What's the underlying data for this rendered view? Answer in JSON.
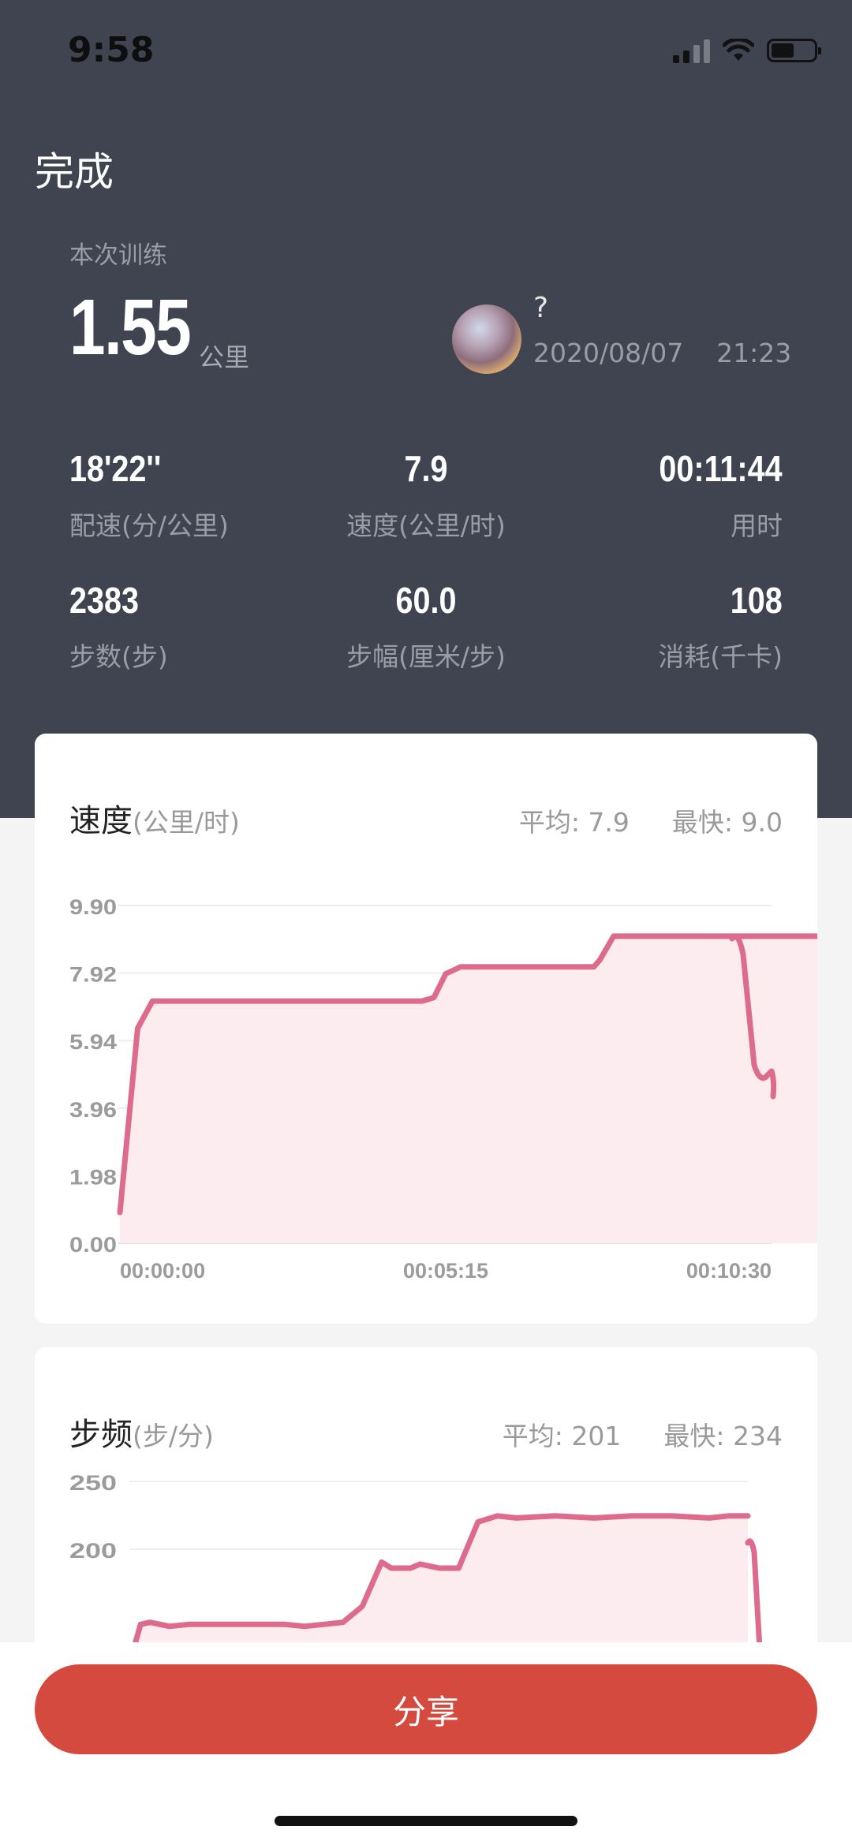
{
  "status": {
    "time": "9:58"
  },
  "header": {
    "done_label": "完成"
  },
  "summary": {
    "session_label": "本次训练",
    "distance": "1.55",
    "distance_unit": "公里",
    "username": "?",
    "date": "2020/08/07",
    "time": "21:23"
  },
  "stats": [
    {
      "value": "18'22''",
      "label": "配速(分/公里)"
    },
    {
      "value": "7.9",
      "label": "速度(公里/时)"
    },
    {
      "value": "00:11:44",
      "label": "用时"
    },
    {
      "value": "2383",
      "label": "步数(步)"
    },
    {
      "value": "60.0",
      "label": "步幅(厘米/步)"
    },
    {
      "value": "108",
      "label": "消耗(千卡)"
    }
  ],
  "speed_card": {
    "title": "速度",
    "unit": "(公里/时)",
    "avg_label": "平均: 7.9",
    "max_label": "最快: 9.0"
  },
  "cadence_card": {
    "title": "步频",
    "unit": "(步/分)",
    "avg_label": "平均: 201",
    "max_label": "最快: 234"
  },
  "share_label": "分享",
  "colors": {
    "line": "#dd6b8d",
    "fill": "#fcecef",
    "button": "#d44a3f",
    "header_bg": "#404350"
  },
  "chart_data": [
    {
      "type": "area",
      "yticks": [
        "0.00",
        "1.98",
        "3.96",
        "5.94",
        "7.92",
        "9.90"
      ],
      "xticks": [
        "00:00:00",
        "00:05:15",
        "00:10:30"
      ],
      "ylim": [
        0,
        9.9
      ],
      "xlim": [
        0,
        660
      ],
      "x": [
        0,
        18,
        33,
        66,
        120,
        180,
        220,
        270,
        306,
        318,
        330,
        345,
        380,
        430,
        480,
        486,
        500,
        520,
        540,
        560,
        600,
        640,
        654,
        662,
        665,
        680,
        695,
        710,
        720,
        730,
        740,
        750,
        760
      ],
      "series": [
        {
          "values": [
            0.9,
            6.3,
            7.1,
            7.1,
            7.1,
            7.1,
            7.1,
            7.1,
            7.1,
            7.2,
            7.9,
            8.1,
            8.1,
            8.1,
            8.1,
            8.3,
            9.0,
            9.0,
            9.0,
            9.0,
            9.0,
            9.0,
            9.0,
            9.0,
            9.0,
            9.0,
            9.0,
            9.0,
            9.0,
            9.0,
            9.0,
            9.05,
            9.0
          ]
        }
      ]
    },
    {
      "type": "area",
      "yticks": [
        "250",
        "200"
      ],
      "xticks": [],
      "x": [
        0,
        10,
        20,
        40,
        60,
        80,
        120,
        160,
        180,
        200,
        220,
        240,
        260,
        270,
        290,
        300,
        320,
        340,
        360,
        380,
        400,
        440,
        480,
        520,
        560,
        600,
        620,
        640
      ],
      "series": [
        {
          "values": [
            160,
            177,
            178,
            176,
            177,
            177,
            177,
            177,
            176,
            177,
            178,
            186,
            208,
            205,
            205,
            207,
            205,
            205,
            228,
            231,
            230,
            231,
            230,
            231,
            231,
            230,
            231,
            231
          ]
        }
      ]
    }
  ]
}
